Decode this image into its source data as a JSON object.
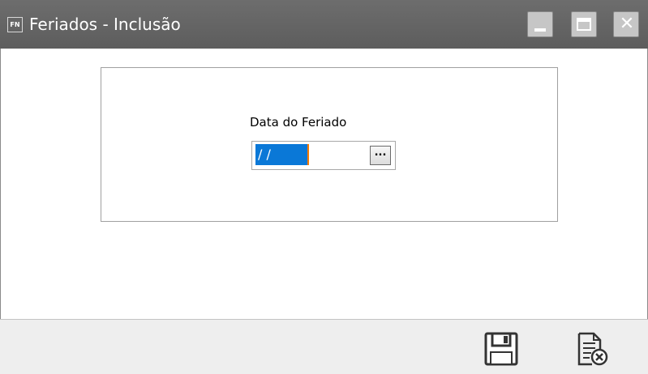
{
  "window": {
    "app_icon_text": "FN",
    "title": "Feriados - Inclusão",
    "controls": {
      "minimize": "minimize-icon",
      "maximize": "maximize-icon",
      "close": "close-icon"
    }
  },
  "form": {
    "date_label": "Data do Feriado",
    "date_value": "/ /",
    "picker_label": "..."
  },
  "toolbar": {
    "save_icon": "save-disk-icon",
    "cancel_icon": "cancel-document-icon"
  },
  "colors": {
    "titlebar": "#666666",
    "selection": "#0a78d7",
    "caret": "#ff7a00",
    "footer": "#eeeeee"
  }
}
